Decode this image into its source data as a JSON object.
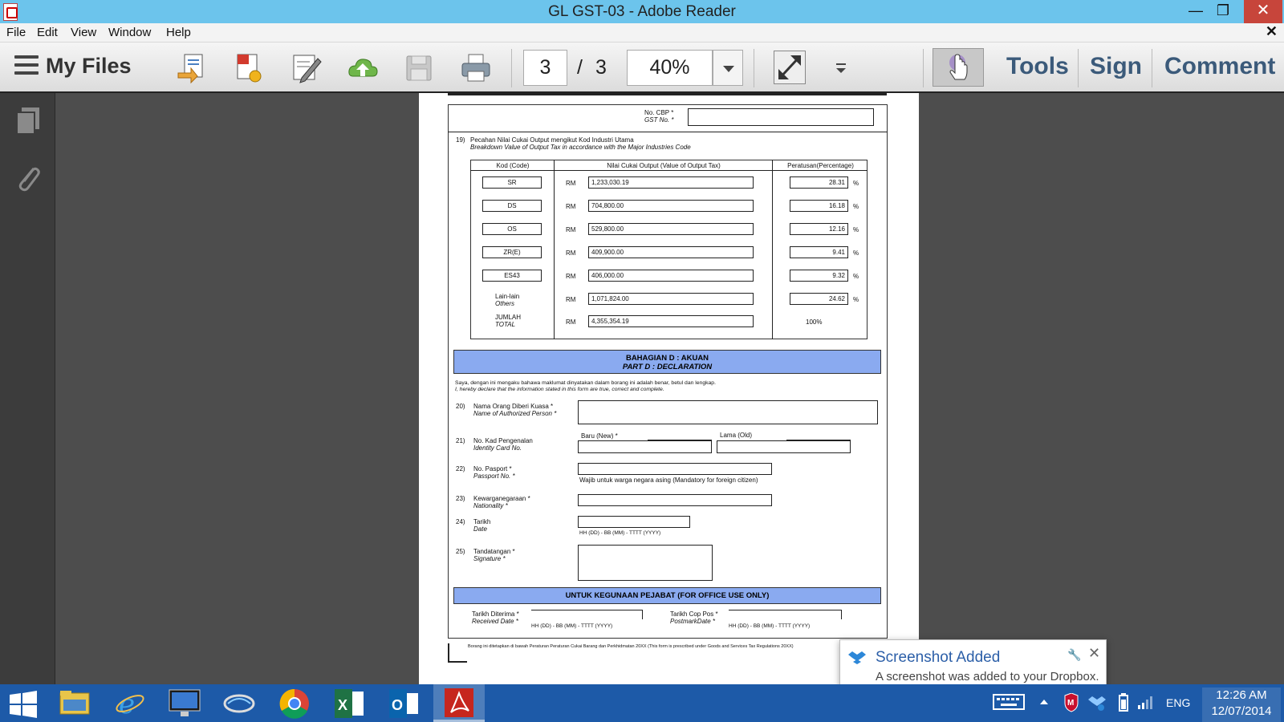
{
  "window": {
    "title": "GL GST-03 - Adobe Reader",
    "minimize": "—",
    "maximize": "❐",
    "close": "✕"
  },
  "menu": {
    "file": "File",
    "edit": "Edit",
    "view": "View",
    "window": "Window",
    "help": "Help",
    "close_doc": "✕"
  },
  "toolbar": {
    "my_files": "My Files",
    "page_current": "3",
    "page_sep": "/",
    "page_total": "3",
    "zoom": "40%",
    "tools": "Tools",
    "sign": "Sign",
    "comment": "Comment",
    "icons": [
      "open-file-icon",
      "create-pdf-icon",
      "edit-icon",
      "upload-cloud-icon",
      "save-icon",
      "print-icon",
      "fullscreen-icon",
      "more-tools-icon",
      "hand-tool-icon"
    ]
  },
  "leftnav": {
    "icons": [
      "pages-icon",
      "attachment-icon"
    ]
  },
  "document": {
    "cbp_label": "No. CBP *",
    "gst_label": "GST No. *",
    "q19_num": "19)",
    "q19_line1": "Pecahan Nilai Cukai Output mengikut Kod Industri Utama",
    "q19_line2": "Breakdown Value of Output Tax in accordance with the Major Industries Code",
    "col_code": "Kod (Code)",
    "col_value": "Nilai Cukai Output (Value of Output Tax)",
    "col_pct": "Peratusan(Percentage)",
    "currency": "RM",
    "pct_sign": "%",
    "rows": [
      {
        "code": "SR",
        "value": "1,233,030.19",
        "pct": "28.31"
      },
      {
        "code": "DS",
        "value": "704,800.00",
        "pct": "16.18"
      },
      {
        "code": "OS",
        "value": "529,800.00",
        "pct": "12.16"
      },
      {
        "code": "ZR(E)",
        "value": "409,900.00",
        "pct": "9.41"
      },
      {
        "code": "ES43",
        "value": "406,000.00",
        "pct": "9.32"
      }
    ],
    "others_label1": "Lain-lain",
    "others_label2": "Others",
    "others_value": "1,071,824.00",
    "others_pct": "24.62",
    "total_label1": "JUMLAH",
    "total_label2": "TOTAL",
    "total_value": "4,355,354.19",
    "total_pct": "100%",
    "partd_title1": "BAHAGIAN D : AKUAN",
    "partd_title2": "PART D : DECLARATION",
    "declare1": "Saya, dengan ini mengaku bahawa maklumat dinyatakan dalam borang ini adalah benar, betul dan lengkap.",
    "declare2": "I, hereby declare that the information stated in this form are true, correct and complete.",
    "q20_num": "20)",
    "q20_l1": "Nama Orang Diberi Kuasa *",
    "q20_l2": "Name of Authorized Person *",
    "q21_num": "21)",
    "q21_l1": "No. Kad Pengenalan",
    "q21_l2": "Identity Card No.",
    "q21_new": "Baru (New) *",
    "q21_old": "Lama (Old)",
    "q22_num": "22)",
    "q22_l1": "No. Pasport  *",
    "q22_l2": "Passport No. *",
    "q22_note": "Wajib untuk warga negara asing (Mandatory for foreign citizen)",
    "q23_num": "23)",
    "q23_l1": "Kewarganegaraan *",
    "q23_l2": "Nationality *",
    "q24_num": "24)",
    "q24_l1": "Tarikh",
    "q24_l2": "Date",
    "date_fmt": "HH (DD)  -  BB (MM)  -  TTTT (YYYY)",
    "q25_num": "25)",
    "q25_l1": "Tandatangan *",
    "q25_l2": "Signature *",
    "office_title": "UNTUK KEGUNAAN PEJABAT (FOR OFFICE USE ONLY)",
    "recv_l1": "Tarikh Diterima *",
    "recv_l2": "Received Date *",
    "post_l1": "Tarikh Cop Pos *",
    "post_l2": "PostmarkDate *",
    "footer": "Borang ini ditetapkan di bawah Peraturan Peraturan Cukai Barang dan Perkhidmatan 20XX (This form is prescribed under Goods and Services Tax Regulations 20XX)"
  },
  "toast": {
    "title": "Screenshot Added",
    "body": "A screenshot was added to your Dropbox.",
    "pin": "🔧",
    "close": "✕"
  },
  "taskbar": {
    "apps": [
      "file-explorer-icon",
      "internet-explorer-icon",
      "lenovo-icon",
      "app-icon",
      "chrome-icon",
      "excel-icon",
      "outlook-icon",
      "acrobat-reader-icon"
    ],
    "lang": "ENG",
    "time": "12:26 AM",
    "date": "12/07/2014"
  }
}
